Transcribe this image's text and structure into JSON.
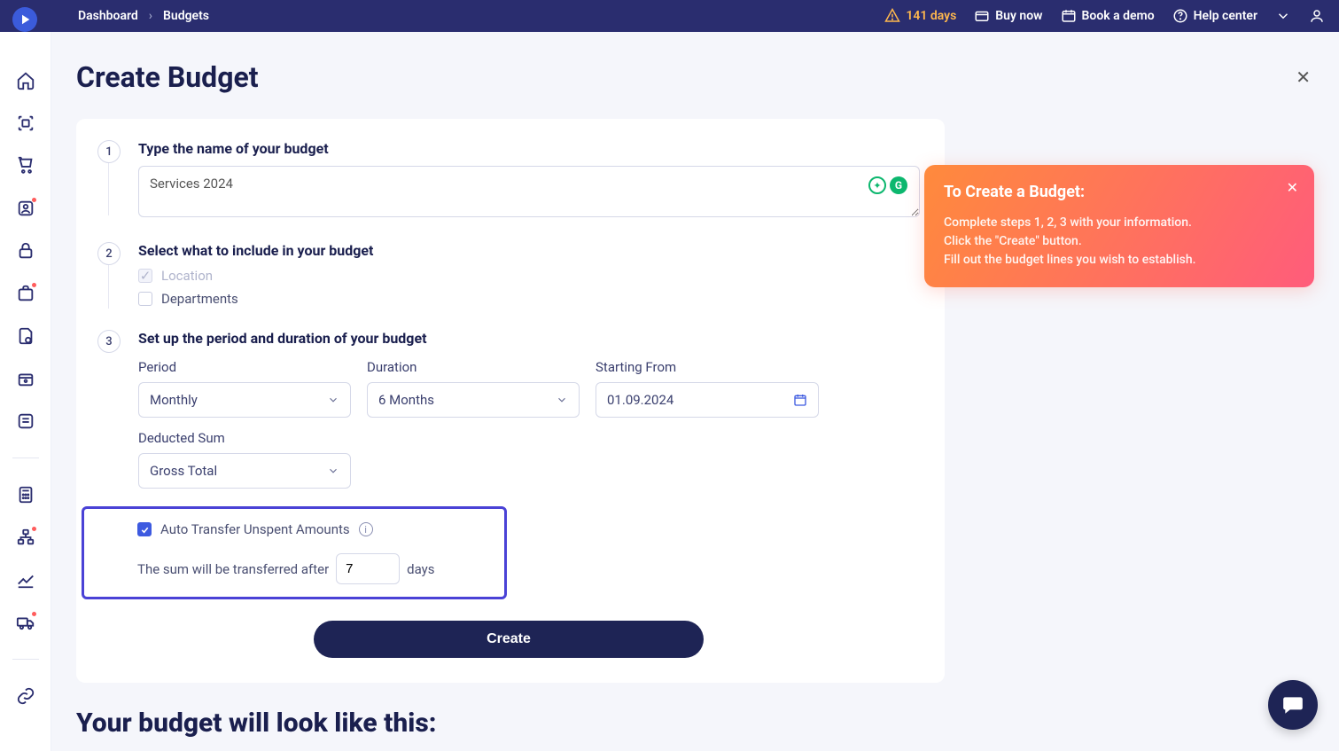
{
  "breadcrumb": {
    "root": "Dashboard",
    "current": "Budgets"
  },
  "topbar": {
    "trial_days": "141 days",
    "buy_now": "Buy now",
    "book_demo": "Book a demo",
    "help_center": "Help center"
  },
  "page": {
    "title": "Create Budget"
  },
  "steps": {
    "s1": {
      "num": "1",
      "title": "Type the name of your budget",
      "value": "Services 2024"
    },
    "s2": {
      "num": "2",
      "title": "Select what to include in your budget",
      "location_label": "Location",
      "departments_label": "Departments"
    },
    "s3": {
      "num": "3",
      "title": "Set up the period and duration of your budget",
      "period_label": "Period",
      "period_value": "Monthly",
      "duration_label": "Duration",
      "duration_value": "6 Months",
      "starting_label": "Starting From",
      "starting_value": "01.09.2024",
      "deducted_label": "Deducted Sum",
      "deducted_value": "Gross Total",
      "auto_transfer_label": "Auto Transfer Unspent Amounts",
      "transfer_pre": "The sum will be transferred after",
      "transfer_days": "7",
      "transfer_post": "days"
    }
  },
  "create_button": "Create",
  "preview_heading": "Your budget will look like this:",
  "tip": {
    "title": "To Create a Budget:",
    "l1": "Complete steps 1, 2, 3 with your information.",
    "l2": "Click the \"Create\" button.",
    "l3": "Fill out the budget lines you wish to establish."
  }
}
